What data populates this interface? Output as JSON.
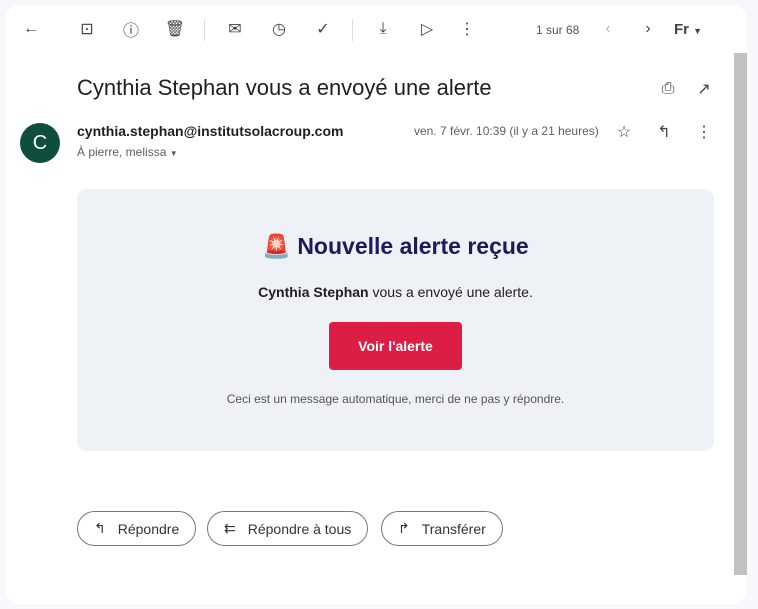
{
  "toolbar": {
    "pagination": "1 sur 68",
    "input_tool": "Fr"
  },
  "email": {
    "subject": "Cynthia Stephan vous a envoyé une alerte",
    "avatar_letter": "C",
    "from": "cynthia.stephan@institutsolacroup.com",
    "to": "À pierre, melissa",
    "date": "ven. 7 févr. 10:39 (il y a 21 heures)"
  },
  "body": {
    "emoji": "🚨",
    "title": "Nouvelle alerte reçue",
    "sender_bold": "Cynthia Stephan",
    "message": " vous a envoyé une alerte.",
    "button": "Voir l'alerte",
    "footer": "Ceci est un message automatique, merci de ne pas y répondre.",
    "button_color": "#dc1d44"
  },
  "actions": {
    "reply": "Répondre",
    "reply_all": "Répondre à tous",
    "forward": "Transférer"
  }
}
